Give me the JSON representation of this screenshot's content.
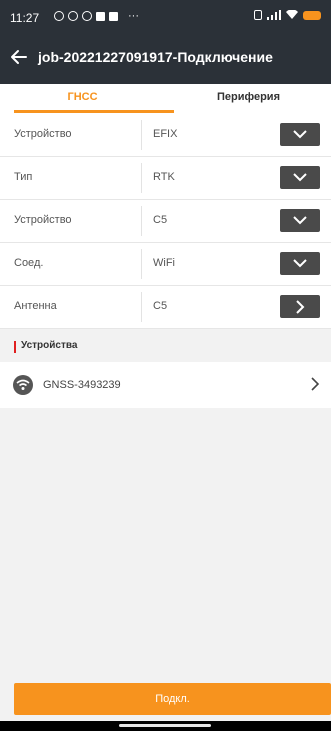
{
  "status_bar": {
    "time": "11:27"
  },
  "header": {
    "title": "job-20221227091917-Подключение"
  },
  "tabs": [
    {
      "label": "ГНСС"
    },
    {
      "label": "Периферия"
    }
  ],
  "settings": [
    {
      "label": "Устройство",
      "value": "EFIX"
    },
    {
      "label": "Тип",
      "value": "RTK"
    },
    {
      "label": "Устройство",
      "value": "C5"
    },
    {
      "label": "Соед.",
      "value": "WiFi"
    },
    {
      "label": "Антенна",
      "value": "C5"
    }
  ],
  "devices_section": {
    "title": "Устройства"
  },
  "device": {
    "name": "GNSS-3493239",
    "icon": "wifi-icon"
  },
  "footer": {
    "connect_label": "Подкл."
  },
  "colors": {
    "accent": "#f7931e",
    "header_bg": "#2b3138",
    "section_marker": "#e02020"
  }
}
